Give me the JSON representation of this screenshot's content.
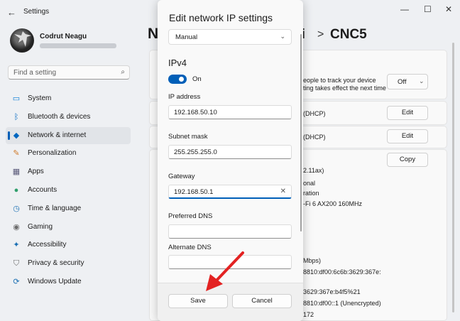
{
  "window": {
    "title": "Settings",
    "controls": [
      "—",
      "☐",
      "✕"
    ]
  },
  "user": {
    "name": "Codrut Neagu"
  },
  "search": {
    "placeholder": "Find a setting"
  },
  "sidebar": {
    "items": [
      {
        "label": "System",
        "icon": "system-icon",
        "glyph": "▭",
        "color": "#0078d4"
      },
      {
        "label": "Bluetooth & devices",
        "icon": "bluetooth-icon",
        "glyph": "ᛒ",
        "color": "#0067c0"
      },
      {
        "label": "Network & internet",
        "icon": "wifi-icon",
        "glyph": "◆",
        "color": "#0067c0",
        "active": true
      },
      {
        "label": "Personalization",
        "icon": "brush-icon",
        "glyph": "✎",
        "color": "#d07a2a"
      },
      {
        "label": "Apps",
        "icon": "apps-icon",
        "glyph": "▦",
        "color": "#5a5a7a"
      },
      {
        "label": "Accounts",
        "icon": "accounts-icon",
        "glyph": "●",
        "color": "#2e9e6b"
      },
      {
        "label": "Time & language",
        "icon": "clock-icon",
        "glyph": "◷",
        "color": "#1a6fb3"
      },
      {
        "label": "Gaming",
        "icon": "gaming-icon",
        "glyph": "◉",
        "color": "#6b6b6b"
      },
      {
        "label": "Accessibility",
        "icon": "accessibility-icon",
        "glyph": "✦",
        "color": "#1a6fb3"
      },
      {
        "label": "Privacy & security",
        "icon": "shield-icon",
        "glyph": "⛉",
        "color": "#6b6b6b"
      },
      {
        "label": "Windows Update",
        "icon": "update-icon",
        "glyph": "⟳",
        "color": "#1a6fb3"
      }
    ]
  },
  "main": {
    "breadcrumb": {
      "first": "N",
      "wifi": "Fi",
      "separator": ">",
      "current": "CNC5"
    },
    "metered_text_1": "eople to track your device",
    "metered_text_2": "ting takes effect the next time",
    "metered_value": "Off",
    "ip_assignment": "(DHCP)",
    "dns_assignment": "(DHCP)",
    "edit_label": "Edit",
    "copy_label": "Copy",
    "props": [
      "2.11ax)",
      "onal",
      "ration",
      "-Fi 6 AX200 160MHz"
    ],
    "props2": [
      "Mbps)",
      "8810:df00:6c6b:3629:367e:",
      "3629:367e:b4f5%21",
      "8810:df00::1 (Unencrypted)",
      "172"
    ]
  },
  "dialog": {
    "title": "Edit network IP settings",
    "mode": "Manual",
    "section": "IPv4",
    "toggle_label": "On",
    "toggle_on": true,
    "fields": {
      "ip_label": "IP address",
      "ip_value": "192.168.50.10",
      "subnet_label": "Subnet mask",
      "subnet_value": "255.255.255.0",
      "gateway_label": "Gateway",
      "gateway_value": "192.168.50.1",
      "dns1_label": "Preferred DNS",
      "dns1_value": "",
      "dns2_label": "Alternate DNS",
      "dns2_value": ""
    },
    "save_label": "Save",
    "cancel_label": "Cancel"
  },
  "colors": {
    "accent": "#005fb8",
    "arrow": "#e32222"
  }
}
